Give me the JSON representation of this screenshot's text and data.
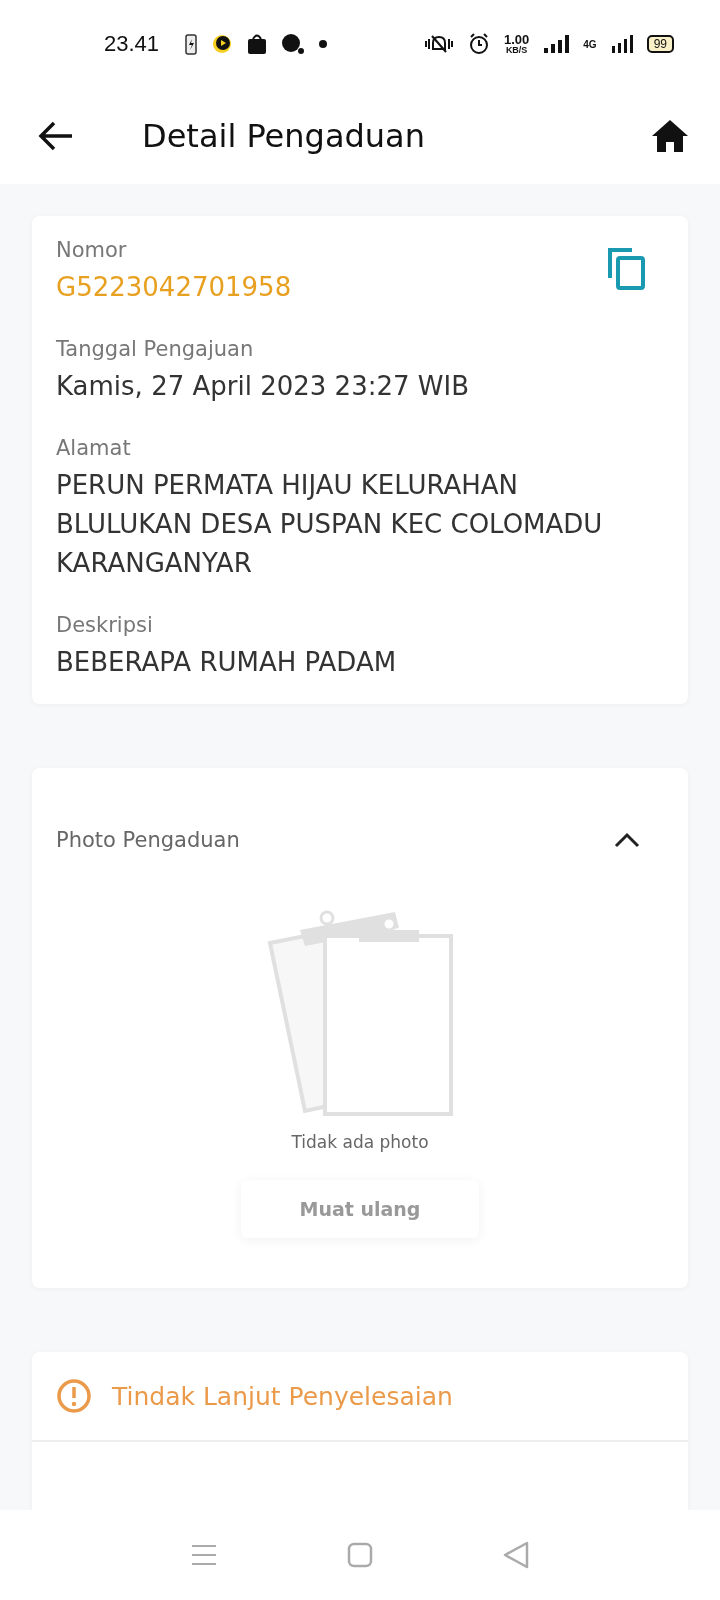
{
  "status_bar": {
    "time": "23.41",
    "speed_value": "1.00",
    "speed_unit": "KB/S",
    "network": "4G",
    "battery": "99"
  },
  "header": {
    "title": "Detail Pengaduan"
  },
  "details": [
    {
      "label": "Nomor",
      "value": "G5223042701958",
      "kind": "number"
    },
    {
      "label": "Tanggal Pengajuan",
      "value": "Kamis, 27 April 2023 23:27 WIB",
      "kind": "text"
    },
    {
      "label": "Alamat",
      "value": "PERUN PERMATA HIJAU KELURAHAN BLULUKAN DESA PUSPAN KEC COLOMADU KARANGANYAR",
      "kind": "text"
    },
    {
      "label": "Deskripsi",
      "value": "BEBERAPA RUMAH PADAM",
      "kind": "text"
    }
  ],
  "photo_section": {
    "title": "Photo Pengaduan",
    "expanded": true,
    "empty_text": "Tidak ada photo",
    "reload_button": "Muat ulang"
  },
  "follow_up": {
    "title": "Tindak Lanjut Penyelesaian"
  }
}
